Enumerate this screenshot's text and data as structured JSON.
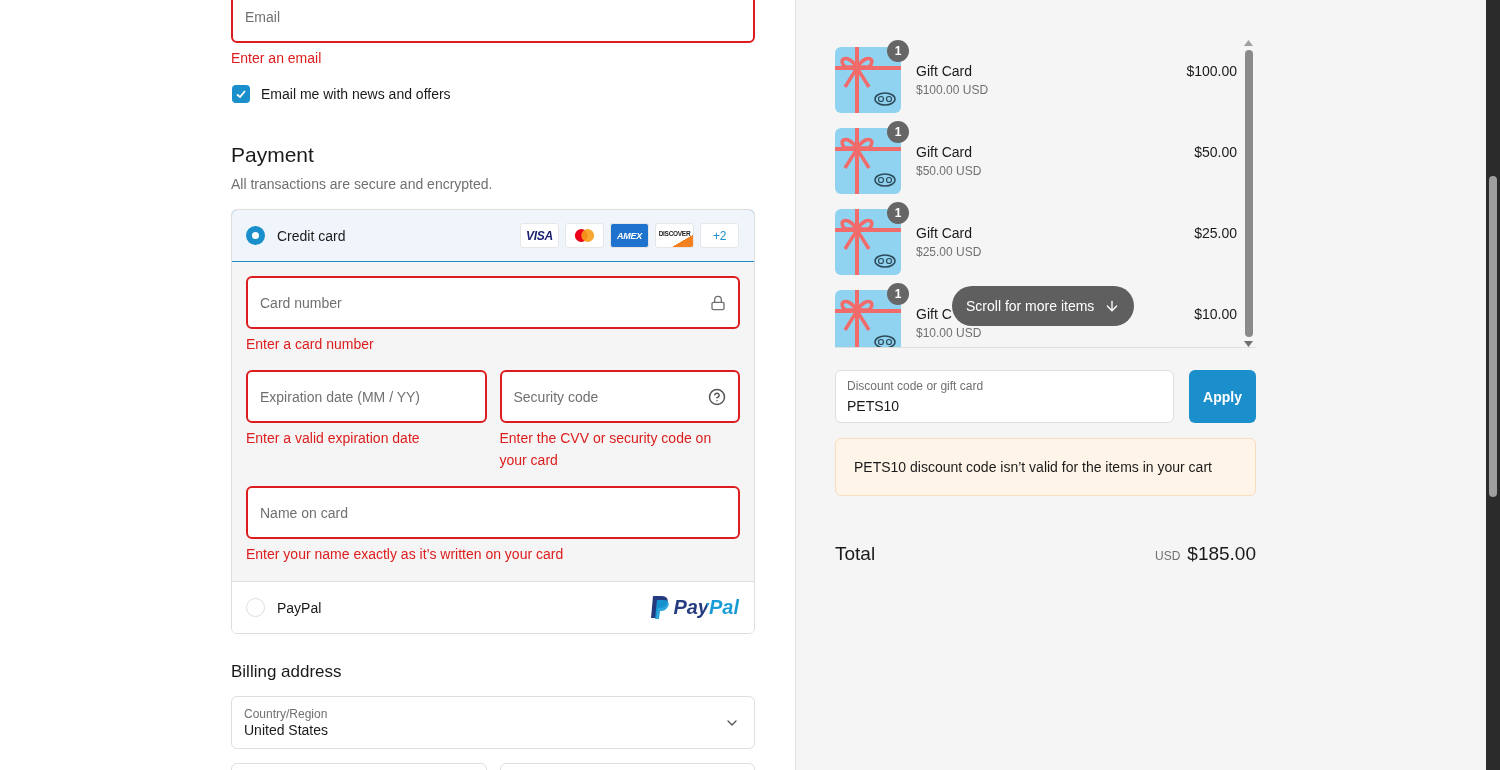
{
  "contact": {
    "email": {
      "placeholder": "Email",
      "error": "Enter an email",
      "invalid": true
    },
    "newsletter": {
      "label": "Email me with news and offers",
      "checked": true
    }
  },
  "payment": {
    "title": "Payment",
    "subtitle": "All transactions are secure and encrypted.",
    "methods": [
      {
        "kind": "card",
        "label": "Credit card",
        "selected": true,
        "brands": [
          {
            "kind": "visa",
            "text": "VISA"
          },
          {
            "kind": "mastercard"
          },
          {
            "kind": "amex",
            "text": "AMEX"
          },
          {
            "kind": "discover",
            "text": "DISCOVER"
          },
          {
            "kind": "more",
            "text": "+2"
          }
        ],
        "field_rows": [
          [
            {
              "placeholder": "Card number",
              "error": "Enter a card number",
              "invalid": true,
              "kind": "lock"
            }
          ],
          [
            {
              "placeholder": "Expiration date (MM / YY)",
              "error": "Enter a valid expiration date",
              "invalid": true
            },
            {
              "placeholder": "Security code",
              "error": "Enter the CVV or security code on your card",
              "invalid": true,
              "kind": "help"
            }
          ],
          [
            {
              "placeholder": "Name on card",
              "error": "Enter your name exactly as it’s written on your card",
              "invalid": true
            }
          ]
        ]
      },
      {
        "kind": "paypal",
        "label": "PayPal",
        "selected": false,
        "logo_text": "PayPal"
      }
    ]
  },
  "billing": {
    "title": "Billing address",
    "country": {
      "label": "Country/Region",
      "value": "United States"
    },
    "next_fields": [
      {
        "kind": "field"
      },
      {
        "kind": "field"
      }
    ]
  },
  "summary": {
    "items": [
      {
        "name": "Gift Card",
        "unit_price": "$100.00 USD",
        "price": "$100.00",
        "quantity": "1"
      },
      {
        "name": "Gift Card",
        "unit_price": "$50.00 USD",
        "price": "$50.00",
        "quantity": "1"
      },
      {
        "name": "Gift Card",
        "unit_price": "$25.00 USD",
        "price": "$25.00",
        "quantity": "1"
      },
      {
        "name": "Gift C",
        "unit_price": "$10.00 USD",
        "price": "$10.00",
        "quantity": "1"
      }
    ],
    "scroll_hint": "Scroll for more items",
    "discount": {
      "label": "Discount code or gift card",
      "value": "PETS10",
      "button": "Apply"
    },
    "alert": "PETS10 discount code isn’t valid for the items in your cart",
    "total": {
      "label": "Total",
      "currency": "USD",
      "amount": "$185.00"
    }
  }
}
